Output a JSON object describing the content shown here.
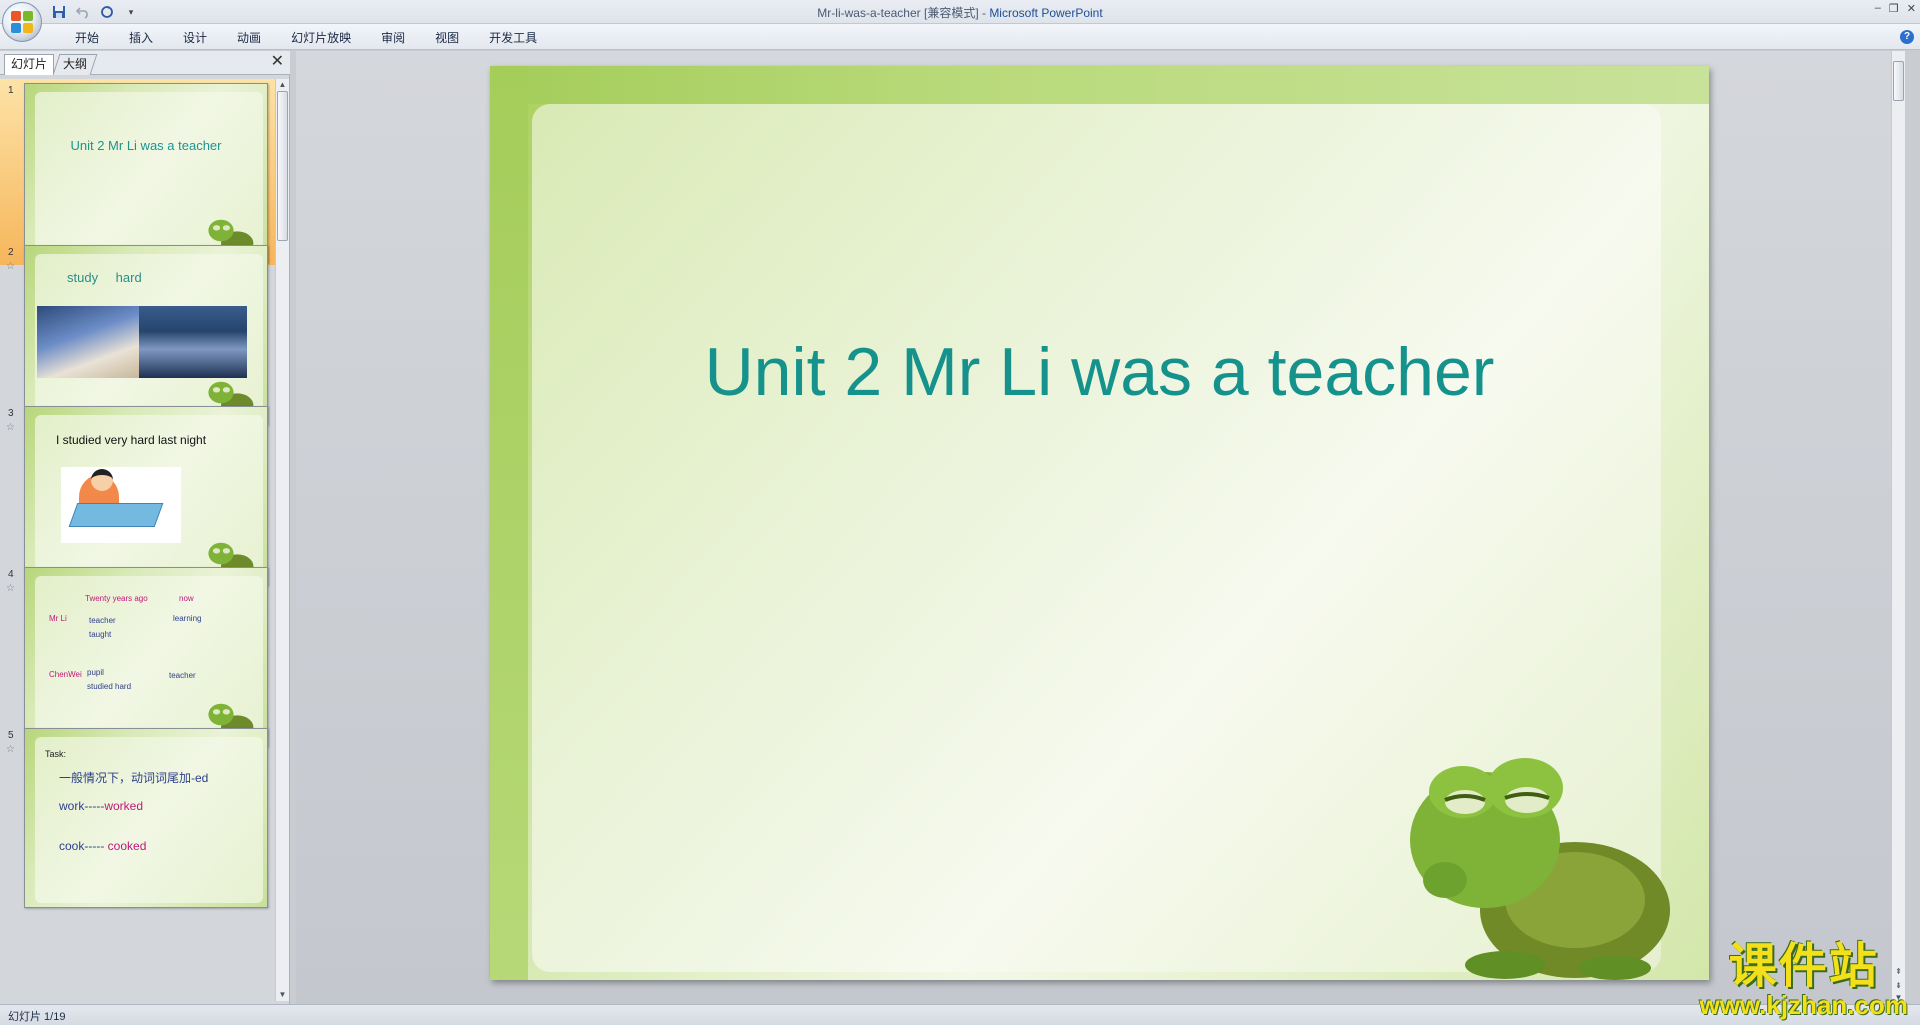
{
  "window": {
    "title": "Mr-li-was-a-teacher [兼容模式] - ",
    "app_name": "Microsoft PowerPoint",
    "controls": [
      "–",
      "❐",
      "✕"
    ]
  },
  "quick_access": {
    "save_icon": "save-icon",
    "undo_icon": "undo-icon",
    "redo_icon": "redo-icon",
    "customize": "▾"
  },
  "ribbon": {
    "tabs": [
      "开始",
      "插入",
      "设计",
      "动画",
      "幻灯片放映",
      "审阅",
      "视图",
      "开发工具"
    ],
    "help": "?"
  },
  "left_panel": {
    "tabs": [
      "幻灯片",
      "大纲"
    ],
    "close": "✕",
    "slides": [
      {
        "number": "1",
        "title": "Unit 2 Mr Li was a teacher"
      },
      {
        "number": "2",
        "text": "study    hard"
      },
      {
        "number": "3",
        "text": "I studied very hard last night"
      },
      {
        "number": "4",
        "items": {
          "twenty": "Twenty years ago",
          "now": "now",
          "mrli": "Mr Li",
          "teacher1": "teacher",
          "taught": "taught",
          "learning": "learning",
          "chenwei": "ChenWei",
          "pupil": "pupil",
          "studied": "studied hard",
          "teacher2": "teacher"
        }
      },
      {
        "number": "5",
        "task": "Task:",
        "rule": "一般情况下，动词词尾加-ed",
        "ex1_a": "work-----",
        "ex1_b": "worked",
        "ex2_a": "cook-----",
        "ex2_b": "cooked"
      }
    ]
  },
  "slide": {
    "title": "Unit 2 Mr Li was a teacher"
  },
  "watermark": {
    "cn": "课件站",
    "url": "www.kjzhan.com"
  },
  "status": {
    "text": "幻灯片 1/19"
  },
  "colors": {
    "title_teal": "#16928c",
    "slide_green": "#a8cf5a",
    "selected_orange": "#f6b65b"
  }
}
